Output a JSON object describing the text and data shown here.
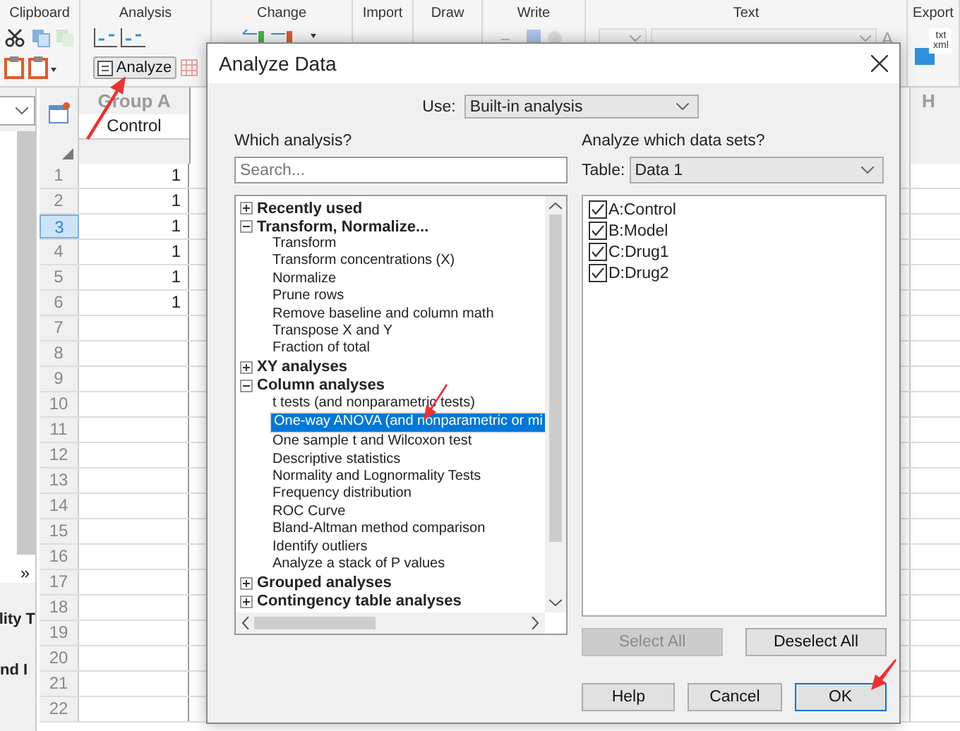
{
  "ribbon": {
    "groups": [
      {
        "label": "Clipboard"
      },
      {
        "label": "Analysis"
      },
      {
        "label": "Change"
      },
      {
        "label": "Import"
      },
      {
        "label": "Draw"
      },
      {
        "label": "Write"
      },
      {
        "label": "Text"
      },
      {
        "label": "Export"
      }
    ],
    "analyze_button": "Analyze",
    "font_button": "A",
    "export_icon_text": [
      "txt",
      "xml"
    ]
  },
  "navigator": {
    "more": "»",
    "items": [
      "lity T",
      "nd I"
    ]
  },
  "sheet": {
    "column_a": {
      "title": "Group A",
      "subtitle": "Control"
    },
    "column_h": {
      "title": "H"
    },
    "rows": [
      {
        "number": "1",
        "selected": false,
        "value": "1"
      },
      {
        "number": "2",
        "selected": false,
        "value": "1"
      },
      {
        "number": "3",
        "selected": true,
        "value": "1"
      },
      {
        "number": "4",
        "selected": false,
        "value": "1"
      },
      {
        "number": "5",
        "selected": false,
        "value": "1"
      },
      {
        "number": "6",
        "selected": false,
        "value": "1"
      },
      {
        "number": "7",
        "selected": false
      },
      {
        "number": "8",
        "selected": false
      },
      {
        "number": "9",
        "selected": false
      },
      {
        "number": "10",
        "selected": false
      },
      {
        "number": "11",
        "selected": false
      },
      {
        "number": "12",
        "selected": false
      },
      {
        "number": "13",
        "selected": false
      },
      {
        "number": "14",
        "selected": false
      },
      {
        "number": "15",
        "selected": false
      },
      {
        "number": "16",
        "selected": false
      },
      {
        "number": "17",
        "selected": false
      },
      {
        "number": "18",
        "selected": false
      },
      {
        "number": "19",
        "selected": false
      },
      {
        "number": "20",
        "selected": false
      },
      {
        "number": "21",
        "selected": false
      },
      {
        "number": "22",
        "selected": false
      }
    ]
  },
  "dialog": {
    "title": "Analyze Data",
    "use_label": "Use:",
    "use_value": "Built-in analysis",
    "which_label": "Which analysis?",
    "search_placeholder": "Search...",
    "tree": [
      {
        "label": "Recently used",
        "expanded": false
      },
      {
        "label": "Transform, Normalize...",
        "expanded": true,
        "children": [
          {
            "label": "Transform",
            "selected": false
          },
          {
            "label": "Transform concentrations (X)",
            "selected": false
          },
          {
            "label": "Normalize",
            "selected": false
          },
          {
            "label": "Prune rows",
            "selected": false
          },
          {
            "label": "Remove baseline and column math",
            "selected": false
          },
          {
            "label": "Transpose X and Y",
            "selected": false
          },
          {
            "label": "Fraction of total",
            "selected": false
          }
        ]
      },
      {
        "label": "XY analyses",
        "expanded": false
      },
      {
        "label": "Column analyses",
        "expanded": true,
        "children": [
          {
            "label": "t tests (and nonparametric tests)",
            "selected": false
          },
          {
            "label": "One-way ANOVA (and nonparametric or mi",
            "selected": true
          },
          {
            "label": "One sample t and Wilcoxon test",
            "selected": false
          },
          {
            "label": "Descriptive statistics",
            "selected": false
          },
          {
            "label": "Normality and Lognormality Tests",
            "selected": false
          },
          {
            "label": "Frequency distribution",
            "selected": false
          },
          {
            "label": "ROC Curve",
            "selected": false
          },
          {
            "label": "Bland-Altman method comparison",
            "selected": false
          },
          {
            "label": "Identify outliers",
            "selected": false
          },
          {
            "label": "Analyze a stack of P values",
            "selected": false
          }
        ]
      },
      {
        "label": "Grouped analyses",
        "expanded": false
      },
      {
        "label": "Contingency table analyses",
        "expanded": false
      }
    ],
    "datasets_label": "Analyze which data sets?",
    "table_label": "Table:",
    "table_value": "Data 1",
    "datasets": [
      {
        "label": "A:Control",
        "checked": true
      },
      {
        "label": "B:Model",
        "checked": true
      },
      {
        "label": "C:Drug1",
        "checked": true
      },
      {
        "label": "D:Drug2",
        "checked": true
      }
    ],
    "select_all": {
      "label": "Select All",
      "disabled": true
    },
    "deselect_all": {
      "label": "Deselect All",
      "disabled": false
    },
    "buttons": [
      {
        "label": "Help",
        "default": false
      },
      {
        "label": "Cancel",
        "default": false
      },
      {
        "label": "OK",
        "default": true
      }
    ]
  }
}
